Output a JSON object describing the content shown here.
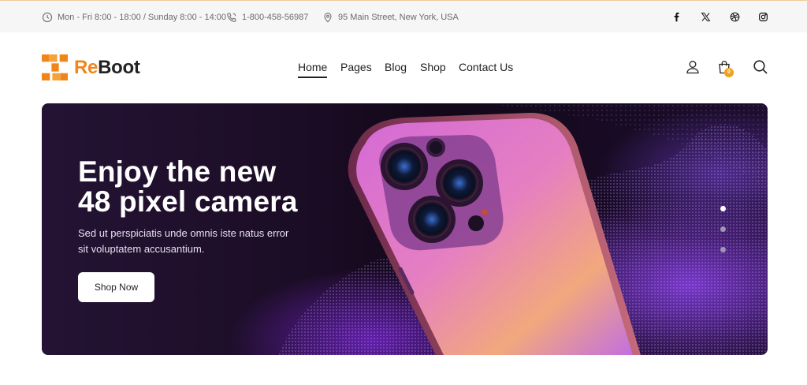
{
  "topbar": {
    "hours": "Mon - Fri 8:00 - 18:00 / Sunday 8:00 - 14:00",
    "phone": "1-800-458-56987",
    "address": "95 Main Street, New York, USA",
    "social": [
      "facebook-icon",
      "x-twitter-icon",
      "dribbble-icon",
      "instagram-icon"
    ]
  },
  "brand": {
    "name_accent": "Re",
    "name_rest": "Boot",
    "accent_color": "#f0861a"
  },
  "nav": {
    "items": [
      "Home",
      "Pages",
      "Blog",
      "Shop",
      "Contact Us"
    ],
    "active": "Home"
  },
  "header_icons": {
    "cart_count": "0"
  },
  "hero": {
    "title_line1": "Enjoy the new",
    "title_line2": "48 pixel camera",
    "subtitle": "Sed ut perspiciatis unde omnis iste natus error sit voluptatem accusantium.",
    "button_label": "Shop Now",
    "slide_count": 3,
    "active_slide": 1
  }
}
